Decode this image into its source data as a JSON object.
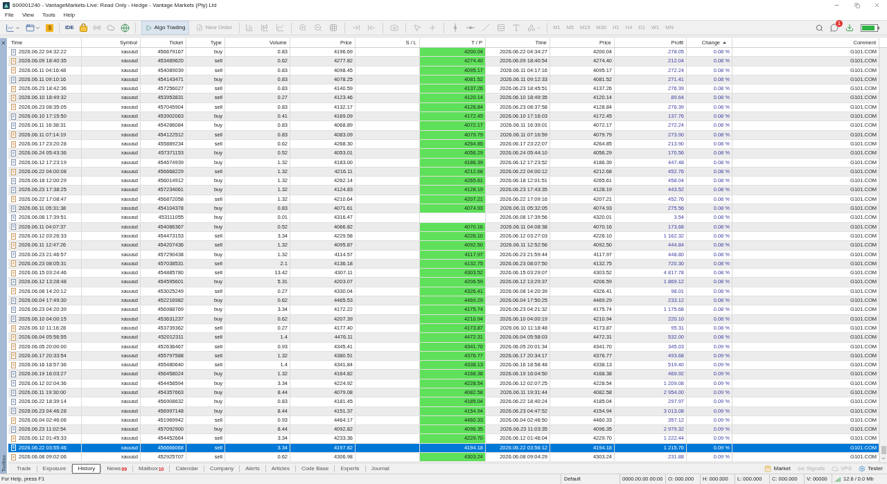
{
  "window": {
    "title": "600001240 - VantageMarkets-Live: Read Only - Hedge - Vantage Markets (Pty) Ltd"
  },
  "menu": [
    "File",
    "View",
    "Tools",
    "Help"
  ],
  "toolbar": {
    "ide": "IDE",
    "algo_trading": {
      "label": "Algo Trading",
      "active": true
    },
    "new_order": {
      "label": "New Order",
      "disabled": true
    },
    "chart_tools": {
      "disabled": true
    },
    "timeframes": [
      {
        "label": "M1",
        "disabled": true
      },
      {
        "label": "M5",
        "disabled": true
      },
      {
        "label": "M15",
        "disabled": true
      },
      {
        "label": "M30",
        "disabled": true
      },
      {
        "label": "H1",
        "disabled": true
      },
      {
        "label": "H4",
        "disabled": true
      },
      {
        "label": "D1",
        "disabled": true
      },
      {
        "label": "W1",
        "disabled": true
      },
      {
        "label": "MN",
        "disabled": true
      }
    ],
    "notifications": {
      "badge": "1"
    }
  },
  "toolbox": {
    "title": "Toolbox"
  },
  "table": {
    "columns": [
      {
        "label": "Time",
        "sorted": false
      },
      {
        "label": "Symbol",
        "sorted": false
      },
      {
        "label": "Ticket",
        "sorted": false
      },
      {
        "label": "Type",
        "sorted": false
      },
      {
        "label": "Volume",
        "sorted": false
      },
      {
        "label": "Price",
        "sorted": false
      },
      {
        "label": "S / L",
        "sorted": false
      },
      {
        "label": "T / P",
        "sorted": false
      },
      {
        "label": "Time",
        "sorted": false
      },
      {
        "label": "Price",
        "sorted": false
      },
      {
        "label": "Profit",
        "sorted": false
      },
      {
        "label": "Change",
        "sorted": true
      },
      {
        "label": "Comment",
        "sorted": false
      }
    ],
    "rows": [
      {
        "time": "2026.06.22 04:32:22",
        "symbol": "xauusd",
        "ticket": "456679167",
        "type": "buy",
        "kind": "buy",
        "volume": "0.83",
        "price": "4196.69",
        "tp": "4200.04",
        "close_time": "2026.06.22 04:34:27",
        "close_price": "4200.04",
        "profit": "278.05",
        "change": "0.08 %",
        "comment": "G101.COM",
        "selected": false
      },
      {
        "time": "2026.06.09 18:40:35",
        "symbol": "xauusd",
        "ticket": "453489620",
        "type": "sell",
        "kind": "sell",
        "volume": "0.62",
        "price": "4277.82",
        "tp": "4274.40",
        "close_time": "2026.06.09 18:40:54",
        "close_price": "4274.40",
        "profit": "212.04",
        "change": "0.08 %",
        "comment": "G101.COM",
        "selected": false
      },
      {
        "time": "2026.06.11 04:16:48",
        "symbol": "xauusd",
        "ticket": "454089039",
        "type": "sell",
        "kind": "sell",
        "volume": "0.83",
        "price": "4098.45",
        "tp": "4095.17",
        "close_time": "2026.06.11 04:17:16",
        "close_price": "4095.17",
        "profit": "272.24",
        "change": "0.08 %",
        "comment": "G101.COM",
        "selected": false
      },
      {
        "time": "2026.06.11 09:10:16",
        "symbol": "xauusd",
        "ticket": "454143471",
        "type": "buy",
        "kind": "buy",
        "volume": "0.83",
        "price": "4078.25",
        "tp": "4081.52",
        "close_time": "2026.06.11 09:12:33",
        "close_price": "4081.52",
        "profit": "271.41",
        "change": "0.08 %",
        "comment": "G101.COM",
        "selected": false
      },
      {
        "time": "2026.06.23 18:42:36",
        "symbol": "xauusd",
        "ticket": "457256027",
        "type": "sell",
        "kind": "sell",
        "volume": "0.83",
        "price": "4140.59",
        "tp": "4137.26",
        "close_time": "2026.06.23 18:45:51",
        "close_price": "4137.26",
        "profit": "276.39",
        "change": "0.08 %",
        "comment": "G101.COM",
        "selected": false
      },
      {
        "time": "2026.06.10 18:49:32",
        "symbol": "xauusd",
        "ticket": "453953831",
        "type": "sell",
        "kind": "sell",
        "volume": "0.27",
        "price": "4123.46",
        "tp": "4120.14",
        "close_time": "2026.06.10 18:49:35",
        "close_price": "4120.14",
        "profit": "89.64",
        "change": "0.08 %",
        "comment": "G101.COM",
        "selected": false
      },
      {
        "time": "2026.06.23 08:35:05",
        "symbol": "xauusd",
        "ticket": "457045904",
        "type": "sell",
        "kind": "sell",
        "volume": "0.83",
        "price": "4132.17",
        "tp": "4128.84",
        "close_time": "2026.06.23 08:37:58",
        "close_price": "4128.84",
        "profit": "276.39",
        "change": "0.08 %",
        "comment": "G101.COM",
        "selected": false
      },
      {
        "time": "2026.06.10 17:15:50",
        "symbol": "xauusd",
        "ticket": "453902063",
        "type": "buy",
        "kind": "buy",
        "volume": "0.41",
        "price": "4169.09",
        "tp": "4172.45",
        "close_time": "2026.06.10 17:16:03",
        "close_price": "4172.45",
        "profit": "137.76",
        "change": "0.08 %",
        "comment": "G101.COM",
        "selected": false
      },
      {
        "time": "2026.06.11 16:38:31",
        "symbol": "xauusd",
        "ticket": "454286084",
        "type": "buy",
        "kind": "buy",
        "volume": "0.83",
        "price": "4068.89",
        "tp": "4072.17",
        "close_time": "2026.06.11 16:39:01",
        "close_price": "4072.17",
        "profit": "272.24",
        "change": "0.08 %",
        "comment": "G101.COM",
        "selected": false
      },
      {
        "time": "2026.06.11 07:14:19",
        "symbol": "xauusd",
        "ticket": "454122512",
        "type": "sell",
        "kind": "sell",
        "volume": "0.83",
        "price": "4083.09",
        "tp": "4079.79",
        "close_time": "2026.06.11 07:16:59",
        "close_price": "4079.79",
        "profit": "273.90",
        "change": "0.08 %",
        "comment": "G101.COM",
        "selected": false
      },
      {
        "time": "2026.06.17 23:20:28",
        "symbol": "xauusd",
        "ticket": "455889234",
        "type": "sell",
        "kind": "sell",
        "volume": "0.62",
        "price": "4268.30",
        "tp": "4264.85",
        "close_time": "2026.06.17 23:22:07",
        "close_price": "4264.85",
        "profit": "213.90",
        "change": "0.08 %",
        "comment": "G101.COM",
        "selected": false
      },
      {
        "time": "2026.06.24 05:43:36",
        "symbol": "xauusd",
        "ticket": "457371153",
        "type": "buy",
        "kind": "buy",
        "volume": "0.52",
        "price": "4053.01",
        "tp": "4056.29",
        "close_time": "2026.06.24 05:44:10",
        "close_price": "4056.29",
        "profit": "170.56",
        "change": "0.08 %",
        "comment": "G101.COM",
        "selected": false
      },
      {
        "time": "2026.06.12 17:23:19",
        "symbol": "xauusd",
        "ticket": "454674939",
        "type": "buy",
        "kind": "buy",
        "volume": "1.32",
        "price": "4183.00",
        "tp": "4186.39",
        "close_time": "2026.06.12 17:23:52",
        "close_price": "4186.39",
        "profit": "447.48",
        "change": "0.08 %",
        "comment": "G101.COM",
        "selected": false
      },
      {
        "time": "2026.06.22 04:00:08",
        "symbol": "xauusd",
        "ticket": "456668229",
        "type": "sell",
        "kind": "sell",
        "volume": "1.32",
        "price": "4216.11",
        "tp": "4212.68",
        "close_time": "2026.06.22 04:00:12",
        "close_price": "4212.68",
        "profit": "452.76",
        "change": "0.08 %",
        "comment": "G101.COM",
        "selected": false
      },
      {
        "time": "2026.06.18 12:00:29",
        "symbol": "xauusd",
        "ticket": "456014912",
        "type": "buy",
        "kind": "buy",
        "volume": "1.32",
        "price": "4262.14",
        "tp": "4265.61",
        "close_time": "2026.06.18 12:01:51",
        "close_price": "4265.61",
        "profit": "458.04",
        "change": "0.08 %",
        "comment": "G101.COM",
        "selected": false
      },
      {
        "time": "2026.06.23 17:38:25",
        "symbol": "xauusd",
        "ticket": "457234061",
        "type": "buy",
        "kind": "buy",
        "volume": "1.32",
        "price": "4124.83",
        "tp": "4128.19",
        "close_time": "2026.06.23 17:43:35",
        "close_price": "4128.19",
        "profit": "443.52",
        "change": "0.08 %",
        "comment": "G101.COM",
        "selected": false
      },
      {
        "time": "2026.06.22 17:08:47",
        "symbol": "xauusd",
        "ticket": "456872058",
        "type": "sell",
        "kind": "sell",
        "volume": "1.32",
        "price": "4210.64",
        "tp": "4207.21",
        "close_time": "2026.06.22 17:09:16",
        "close_price": "4207.21",
        "profit": "452.76",
        "change": "0.08 %",
        "comment": "G101.COM",
        "selected": false
      },
      {
        "time": "2026.06.11 05:31:38",
        "symbol": "xauusd",
        "ticket": "454104378",
        "type": "buy",
        "kind": "buy",
        "volume": "0.83",
        "price": "4071.61",
        "tp": "4074.93",
        "close_time": "2026.06.11 05:32:05",
        "close_price": "4074.93",
        "profit": "275.56",
        "change": "0.08 %",
        "comment": "G101.COM",
        "selected": false
      },
      {
        "time": "2026.06.08 17:39:51",
        "symbol": "xauusd",
        "ticket": "453111055",
        "type": "buy",
        "kind": "buy",
        "volume": "0.01",
        "price": "4316.47",
        "close_time": "2026.06.08 17:39:56",
        "close_price": "4320.01",
        "profit": "3.54",
        "change": "0.08 %",
        "comment": "G101.COM",
        "selected": false
      },
      {
        "time": "2026.06.11 04:07:37",
        "symbol": "xauusd",
        "ticket": "454086367",
        "type": "buy",
        "kind": "buy",
        "volume": "0.52",
        "price": "4066.82",
        "tp": "4070.16",
        "close_time": "2026.06.11 04:08:38",
        "close_price": "4070.16",
        "profit": "173.68",
        "change": "0.08 %",
        "comment": "G101.COM",
        "selected": false
      },
      {
        "time": "2026.06.12 03:26:33",
        "symbol": "xauusd",
        "ticket": "454473153",
        "type": "sell",
        "kind": "sell",
        "volume": "3.34",
        "price": "4229.58",
        "tp": "4226.10",
        "close_time": "2026.06.12 03:27:03",
        "close_price": "4226.10",
        "profit": "1 162.32",
        "change": "0.08 %",
        "comment": "G101.COM",
        "selected": false
      },
      {
        "time": "2026.06.11 12:47:26",
        "symbol": "xauusd",
        "ticket": "454207436",
        "type": "sell",
        "kind": "sell",
        "volume": "1.32",
        "price": "4095.87",
        "tp": "4092.50",
        "close_time": "2026.06.11 12:52:56",
        "close_price": "4092.50",
        "profit": "444.84",
        "change": "0.08 %",
        "comment": "G101.COM",
        "selected": false
      },
      {
        "time": "2026.06.23 21:46:57",
        "symbol": "xauusd",
        "ticket": "457290438",
        "type": "buy",
        "kind": "buy",
        "volume": "1.32",
        "price": "4114.57",
        "tp": "4117.97",
        "close_time": "2026.06.23 21:59:44",
        "close_price": "4117.97",
        "profit": "448.80",
        "change": "0.08 %",
        "comment": "G101.COM",
        "selected": false
      },
      {
        "time": "2026.06.23 08:05:31",
        "symbol": "xauusd",
        "ticket": "457038531",
        "type": "sell",
        "kind": "sell",
        "volume": "2.1",
        "price": "4136.18",
        "tp": "4132.75",
        "close_time": "2026.06.23 08:07:50",
        "close_price": "4132.75",
        "profit": "720.30",
        "change": "0.08 %",
        "comment": "G101.COM",
        "selected": false
      },
      {
        "time": "2026.06.15 03:24:46",
        "symbol": "xauusd",
        "ticket": "454885780",
        "type": "sell",
        "kind": "sell",
        "volume": "13.42",
        "price": "4307.11",
        "tp": "4303.52",
        "close_time": "2026.06.15 03:29:07",
        "close_price": "4303.52",
        "profit": "4 817.78",
        "change": "0.08 %",
        "comment": "G101.COM",
        "selected": false
      },
      {
        "time": "2026.06.12 13:28:48",
        "symbol": "xauusd",
        "ticket": "454595601",
        "type": "buy",
        "kind": "buy",
        "volume": "5.31",
        "price": "4203.07",
        "tp": "4206.59",
        "close_time": "2026.06.12 13:29:37",
        "close_price": "4206.59",
        "profit": "1 869.12",
        "change": "0.08 %",
        "comment": "G101.COM",
        "selected": false
      },
      {
        "time": "2026.06.08 14:20:12",
        "symbol": "xauusd",
        "ticket": "453025249",
        "type": "sell",
        "kind": "sell",
        "volume": "0.27",
        "price": "4330.04",
        "tp": "4326.41",
        "close_time": "2026.06.08 14:20:39",
        "close_price": "4326.41",
        "profit": "98.01",
        "change": "0.08 %",
        "comment": "G101.COM",
        "selected": false
      },
      {
        "time": "2026.06.04 17:49:30",
        "symbol": "xauusd",
        "ticket": "452216982",
        "type": "buy",
        "kind": "buy",
        "volume": "0.62",
        "price": "4465.53",
        "tp": "4469.29",
        "close_time": "2026.06.04 17:50:25",
        "close_price": "4469.29",
        "profit": "233.12",
        "change": "0.08 %",
        "comment": "G101.COM",
        "selected": false
      },
      {
        "time": "2026.06.23 04:20:39",
        "symbol": "xauusd",
        "ticket": "456988769",
        "type": "buy",
        "kind": "buy",
        "volume": "3.34",
        "price": "4172.22",
        "tp": "4175.74",
        "close_time": "2026.06.23 04:21:32",
        "close_price": "4175.74",
        "profit": "1 175.68",
        "change": "0.08 %",
        "comment": "G101.COM",
        "selected": false
      },
      {
        "time": "2026.06.10 04:00:15",
        "symbol": "xauusd",
        "ticket": "453631237",
        "type": "buy",
        "kind": "buy",
        "volume": "0.62",
        "price": "4207.39",
        "tp": "4210.94",
        "close_time": "2026.06.10 04:00:19",
        "close_price": "4210.94",
        "profit": "220.10",
        "change": "0.08 %",
        "comment": "G101.COM",
        "selected": false
      },
      {
        "time": "2026.06.10 11:16:28",
        "symbol": "xauusd",
        "ticket": "453739362",
        "type": "sell",
        "kind": "sell",
        "volume": "0.27",
        "price": "4177.40",
        "tp": "4173.87",
        "close_time": "2026.06.10 11:18:48",
        "close_price": "4173.87",
        "profit": "95.31",
        "change": "0.08 %",
        "comment": "G101.COM",
        "selected": false
      },
      {
        "time": "2026.06.04 05:56:55",
        "symbol": "xauusd",
        "ticket": "452012311",
        "type": "sell",
        "kind": "sell",
        "volume": "1.4",
        "price": "4476.11",
        "tp": "4472.31",
        "close_time": "2026.06.04 05:58:03",
        "close_price": "4472.31",
        "profit": "532.00",
        "change": "0.08 %",
        "comment": "G101.COM",
        "selected": false
      },
      {
        "time": "2026.06.05 20:00:00",
        "symbol": "xauusd",
        "ticket": "452636467",
        "type": "sell",
        "kind": "sell",
        "volume": "0.93",
        "price": "4345.41",
        "tp": "4341.70",
        "close_time": "2026.06.05 20:01:34",
        "close_price": "4341.70",
        "profit": "345.03",
        "change": "0.09 %",
        "comment": "G101.COM",
        "selected": false
      },
      {
        "time": "2026.06.17 20:33:54",
        "symbol": "xauusd",
        "ticket": "455797588",
        "type": "sell",
        "kind": "sell",
        "volume": "1.32",
        "price": "4380.51",
        "tp": "4376.77",
        "close_time": "2026.06.17 20:34:17",
        "close_price": "4376.77",
        "profit": "493.68",
        "change": "0.09 %",
        "comment": "G101.COM",
        "selected": false
      },
      {
        "time": "2026.06.16 18:57:36",
        "symbol": "xauusd",
        "ticket": "455480640",
        "type": "sell",
        "kind": "sell",
        "volume": "1.4",
        "price": "4341.84",
        "tp": "4338.13",
        "close_time": "2026.06.16 18:58:48",
        "close_price": "4338.13",
        "profit": "519.40",
        "change": "0.09 %",
        "comment": "G101.COM",
        "selected": false
      },
      {
        "time": "2026.06.19 16:03:27",
        "symbol": "xauusd",
        "ticket": "456458024",
        "type": "buy",
        "kind": "buy",
        "volume": "1.32",
        "price": "4164.82",
        "tp": "4168.38",
        "close_time": "2026.06.19 16:04:50",
        "close_price": "4168.38",
        "profit": "469.92",
        "change": "0.09 %",
        "comment": "G101.COM",
        "selected": false
      },
      {
        "time": "2026.06.12 02:04:36",
        "symbol": "xauusd",
        "ticket": "454458594",
        "type": "buy",
        "kind": "buy",
        "volume": "3.34",
        "price": "4224.92",
        "tp": "4228.54",
        "close_time": "2026.06.12 02:07:25",
        "close_price": "4228.54",
        "profit": "1 209.08",
        "change": "0.09 %",
        "comment": "G101.COM",
        "selected": false
      },
      {
        "time": "2026.06.11 19:30:00",
        "symbol": "xauusd",
        "ticket": "454357663",
        "type": "buy",
        "kind": "buy",
        "volume": "8.44",
        "price": "4079.08",
        "tp": "4082.58",
        "close_time": "2026.06.11 19:31:44",
        "close_price": "4082.58",
        "profit": "2 954.00",
        "change": "0.09 %",
        "comment": "G101.COM",
        "selected": false
      },
      {
        "time": "2026.06.22 18:39:14",
        "symbol": "xauusd",
        "ticket": "456908632",
        "type": "buy",
        "kind": "buy",
        "volume": "0.83",
        "price": "4181.45",
        "tp": "4185.04",
        "close_time": "2026.06.22 18:40:24",
        "close_price": "4185.04",
        "profit": "297.97",
        "change": "0.09 %",
        "comment": "G101.COM",
        "selected": false
      },
      {
        "time": "2026.06.23 04:46:28",
        "symbol": "xauusd",
        "ticket": "456997148",
        "type": "buy",
        "kind": "buy",
        "volume": "8.44",
        "price": "4151.37",
        "tp": "4154.94",
        "close_time": "2026.06.23 04:47:52",
        "close_price": "4154.94",
        "profit": "3 013.08",
        "change": "0.09 %",
        "comment": "G101.COM",
        "selected": false
      },
      {
        "time": "2026.06.04 02:46:06",
        "symbol": "xauusd",
        "ticket": "451969942",
        "type": "sell",
        "kind": "sell",
        "volume": "0.93",
        "price": "4464.17",
        "tp": "4460.33",
        "close_time": "2026.06.04 02:46:50",
        "close_price": "4460.33",
        "profit": "357.12",
        "change": "0.09 %",
        "comment": "G101.COM",
        "selected": false
      },
      {
        "time": "2026.06.23 11:02:54",
        "symbol": "xauusd",
        "ticket": "457092900",
        "type": "buy",
        "kind": "buy",
        "volume": "8.44",
        "price": "4092.82",
        "tp": "4096.35",
        "close_time": "2026.06.23 11:03:35",
        "close_price": "4096.35",
        "profit": "2 979.32",
        "change": "0.09 %",
        "comment": "G101.COM",
        "selected": false
      },
      {
        "time": "2026.06.12 01:45:33",
        "symbol": "xauusd",
        "ticket": "454452664",
        "type": "sell",
        "kind": "sell",
        "volume": "3.34",
        "price": "4233.36",
        "tp": "4229.70",
        "close_time": "2026.06.12 01:46:04",
        "close_price": "4229.70",
        "profit": "1 222.44",
        "change": "0.09 %",
        "comment": "G101.COM",
        "selected": false
      },
      {
        "time": "2026.06.22 03:55:46",
        "symbol": "xauusd",
        "ticket": "456666068",
        "type": "sell",
        "kind": "sell",
        "volume": "3.34",
        "price": "4197.82",
        "tp": "4194.18",
        "close_time": "2026.06.22 03:56:12",
        "close_price": "4194.18",
        "profit": "1 215.76",
        "change": "0.09 %",
        "comment": "G101.COM",
        "selected": true
      },
      {
        "time": "2026.06.08 09:02:06",
        "symbol": "xauusd",
        "ticket": "452925707",
        "type": "sell",
        "kind": "sell",
        "volume": "0.62",
        "price": "4306.98",
        "tp": "4303.24",
        "close_time": "2026.06.08 09:04:29",
        "close_price": "4303.24",
        "profit": "231.88",
        "change": "0.09 %",
        "comment": "G101.COM",
        "selected": false
      }
    ]
  },
  "bottom_tabs": [
    {
      "label": "Trade",
      "selected": false
    },
    {
      "label": "Exposure",
      "selected": false
    },
    {
      "label": "History",
      "selected": true
    },
    {
      "label": "News",
      "selected": false,
      "badge": "99"
    },
    {
      "label": "Mailbox",
      "selected": false,
      "badge": "10"
    },
    {
      "label": "Calendar",
      "selected": false
    },
    {
      "label": "Company",
      "selected": false
    },
    {
      "label": "Alerts",
      "selected": false
    },
    {
      "label": "Articles",
      "selected": false
    },
    {
      "label": "Code Base",
      "selected": false
    },
    {
      "label": "Experts",
      "selected": false
    },
    {
      "label": "Journal",
      "selected": false
    }
  ],
  "panel_buttons": [
    {
      "label": "Market",
      "kind": "market",
      "disabled": false
    },
    {
      "label": "Signals",
      "kind": "signals",
      "disabled": true
    },
    {
      "label": "VPS",
      "kind": "vps",
      "disabled": true
    },
    {
      "label": "Tester",
      "kind": "tester",
      "disabled": false
    }
  ],
  "status_bar": {
    "help": "For Help, press F1",
    "profile": "Default",
    "datetime": "0000.00.00 00:00",
    "open": "O: 000.000",
    "high": "H: 000.000",
    "low": "L: 000.000",
    "close": "C: 000.000",
    "volume": "V: 00000",
    "traffic": "12.6 / 0.0 Mb"
  }
}
